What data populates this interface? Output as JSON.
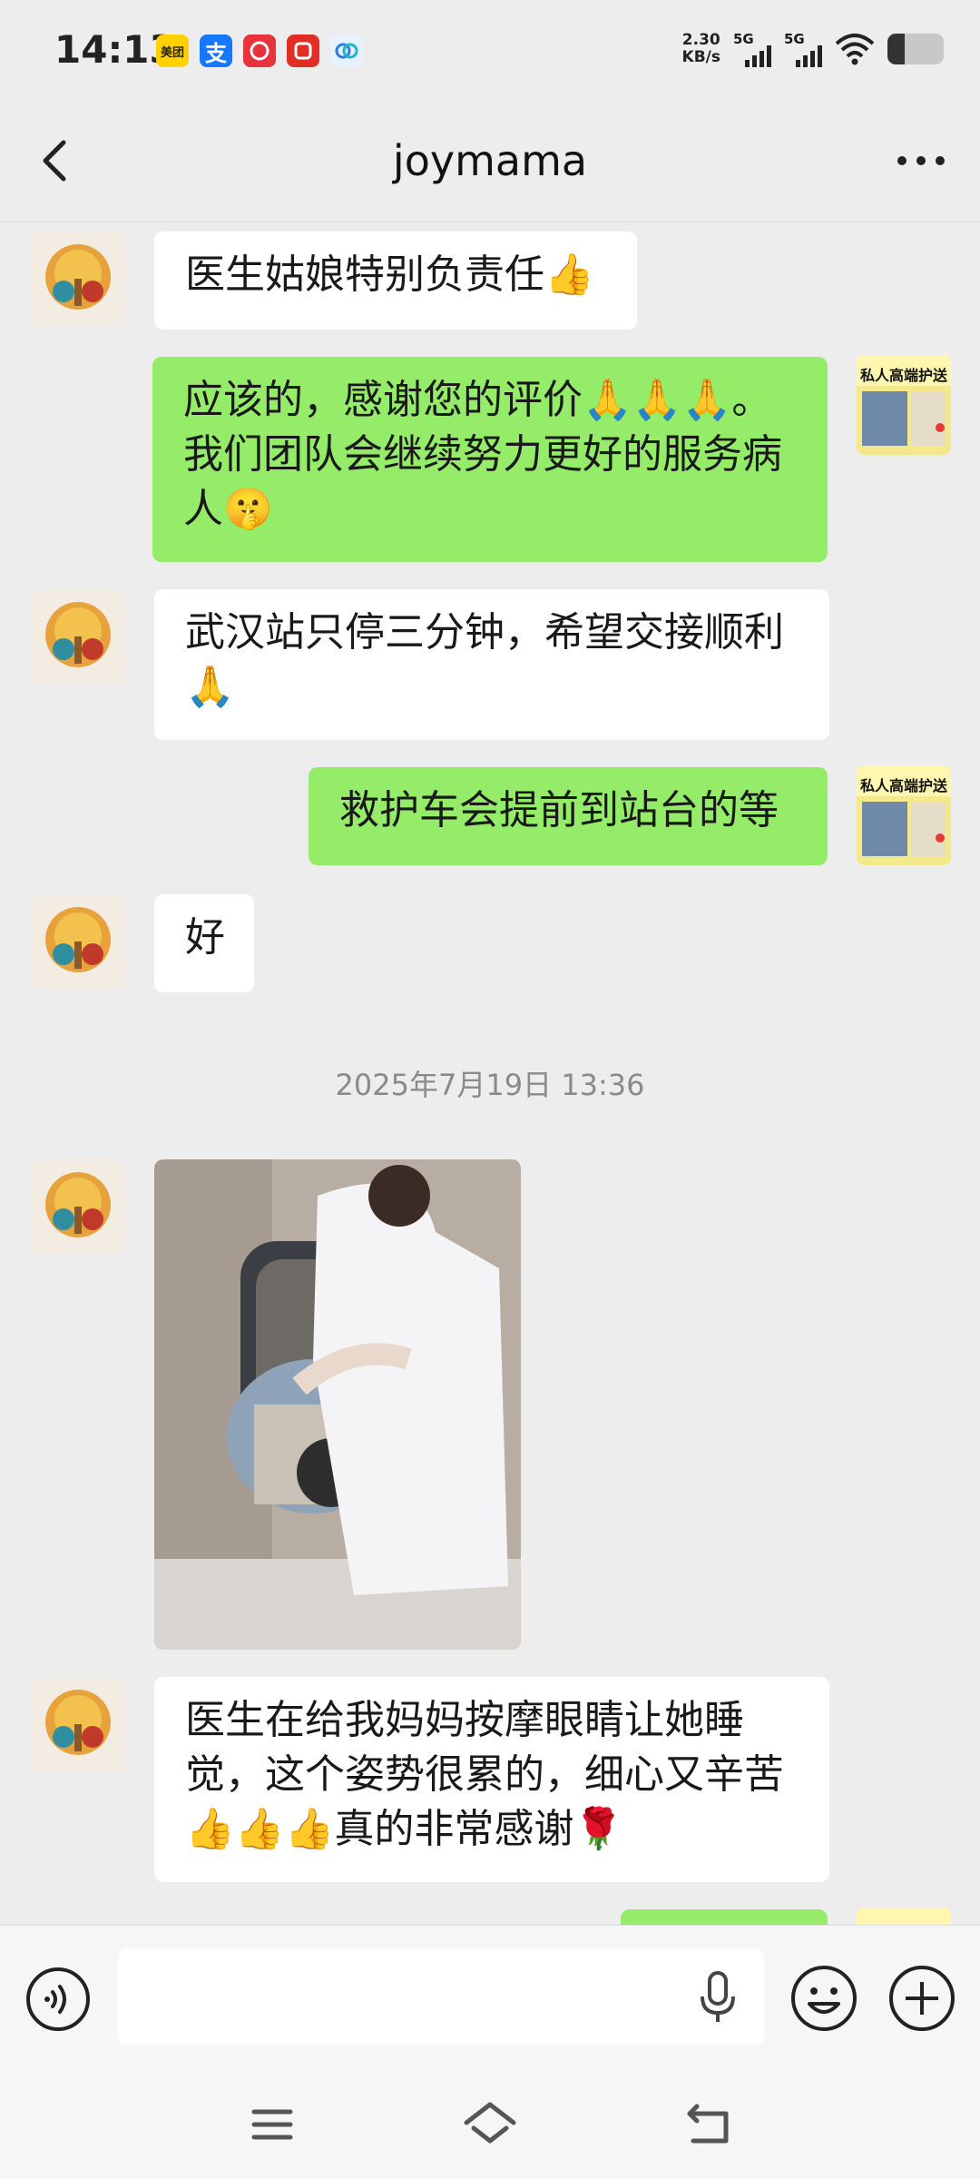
{
  "status_bar": {
    "time": "14:13",
    "apps": [
      {
        "icon": "meituan-icon",
        "label": "美团",
        "bg": "#ffd100",
        "fg": "#222"
      },
      {
        "icon": "alipay-icon",
        "label": "支",
        "bg": "#1677ff",
        "fg": "#fff"
      },
      {
        "icon": "app-red-icon",
        "label": "",
        "bg": "#e8323c",
        "fg": "#fff"
      },
      {
        "icon": "pinduoduo-icon",
        "label": "",
        "bg": "#e02e24",
        "fg": "#fff"
      },
      {
        "icon": "app-blue-icon",
        "label": "",
        "bg": "#e8f1ff",
        "fg": "#2a7de1"
      }
    ],
    "net_speed_value": "2.30",
    "net_speed_unit": "KB/s",
    "signal_1_label": "5G",
    "signal_2_label": "5G",
    "battery_level": 0.3
  },
  "header": {
    "title": "joymama"
  },
  "messages": [
    {
      "side": "in",
      "text": "医生姑娘特别负责任👍"
    },
    {
      "side": "out",
      "text": "应该的，感谢您的评价🙏🙏🙏。我们团队会继续努力更好的服务病人🤫"
    },
    {
      "side": "in",
      "text": "武汉站只停三分钟，希望交接顺利🙏"
    },
    {
      "side": "out",
      "text": "救护车会提前到站台的等"
    },
    {
      "side": "in",
      "text": "好"
    },
    {
      "side": "in",
      "text": "医生在给我妈妈按摩眼睛让她睡觉，这个姿势很累的，细心又辛苦👍👍👍真的非常感谢🌹"
    }
  ],
  "timestamp": "2025年7月19日 13:36",
  "self_avatar_text": "私人高端护送",
  "input": {
    "value": "",
    "placeholder": ""
  },
  "colors": {
    "background": "#ededed",
    "incoming_bubble": "#ffffff",
    "outgoing_bubble": "#95ec69",
    "timestamp_text": "#8a8a8a"
  }
}
